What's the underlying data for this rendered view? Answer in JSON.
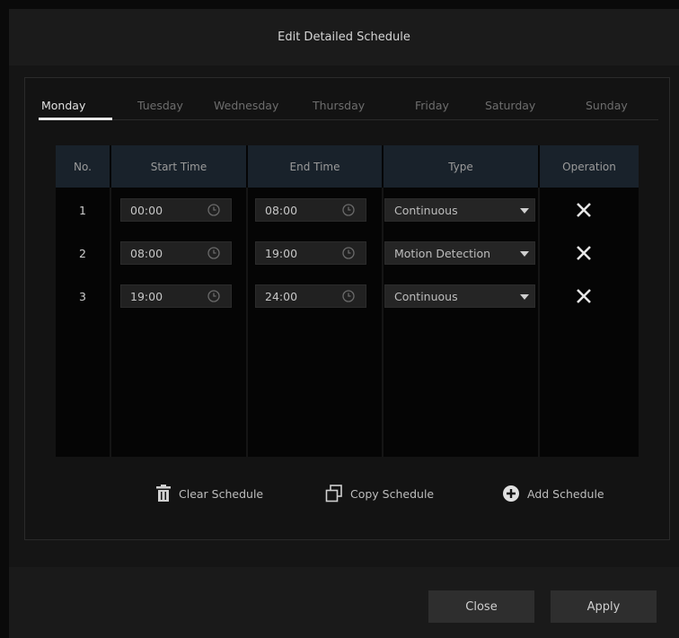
{
  "dialog": {
    "title": "Edit Detailed Schedule"
  },
  "tabs": [
    "Monday",
    "Tuesday",
    "Wednesday",
    "Thursday",
    "Friday",
    "Saturday",
    "Sunday"
  ],
  "active_tab": "Monday",
  "table": {
    "headers": {
      "no": "No.",
      "start": "Start Time",
      "end": "End Time",
      "type": "Type",
      "operation": "Operation"
    },
    "rows": [
      {
        "no": "1",
        "start": "00:00",
        "end": "08:00",
        "type": "Continuous"
      },
      {
        "no": "2",
        "start": "08:00",
        "end": "19:00",
        "type": "Motion Detection"
      },
      {
        "no": "3",
        "start": "19:00",
        "end": "24:00",
        "type": "Continuous"
      }
    ]
  },
  "actions": {
    "clear": "Clear Schedule",
    "copy": "Copy Schedule",
    "add": "Add Schedule"
  },
  "footer": {
    "close": "Close",
    "apply": "Apply"
  },
  "icons": {
    "clock": "clock-icon",
    "delete": "close-icon",
    "dropdown": "chevron-down-icon",
    "trash": "trash-icon",
    "copy": "copy-icon",
    "add": "plus-circle-icon"
  },
  "colors": {
    "background": "#0a0a0a",
    "dialog": "#151515",
    "header_cell": "#19222b",
    "field": "#212121",
    "button": "#2e2e2e",
    "text": "#c8c8c8"
  }
}
